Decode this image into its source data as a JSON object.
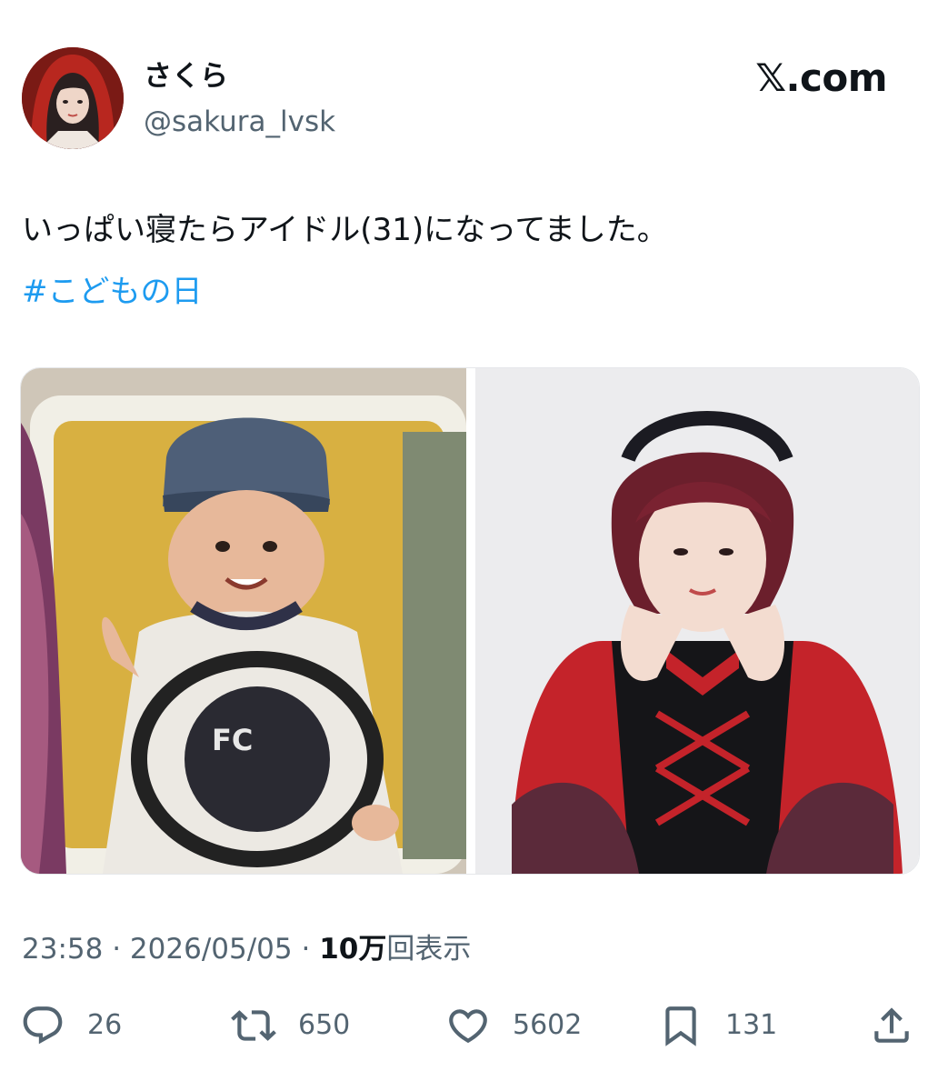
{
  "author": {
    "display_name": "さくら",
    "handle": "@sakura_lvsk"
  },
  "brand": "𝕏.com",
  "tweet": {
    "text": "いっぱい寝たらアイドル(31)になってました。",
    "hashtag": "#こどもの日"
  },
  "media": [
    {
      "description": "child-photo-icon"
    },
    {
      "description": "idol-photo-icon"
    }
  ],
  "meta": {
    "time": "23:58",
    "separator": "·",
    "date": "2026/05/05",
    "views_number": "10万",
    "views_label": "回表示"
  },
  "actions": {
    "replies": "26",
    "reposts": "650",
    "likes": "5602",
    "bookmarks": "131"
  },
  "colors": {
    "link": "#1d9bf0",
    "muted": "#536471",
    "text": "#0f1419"
  }
}
